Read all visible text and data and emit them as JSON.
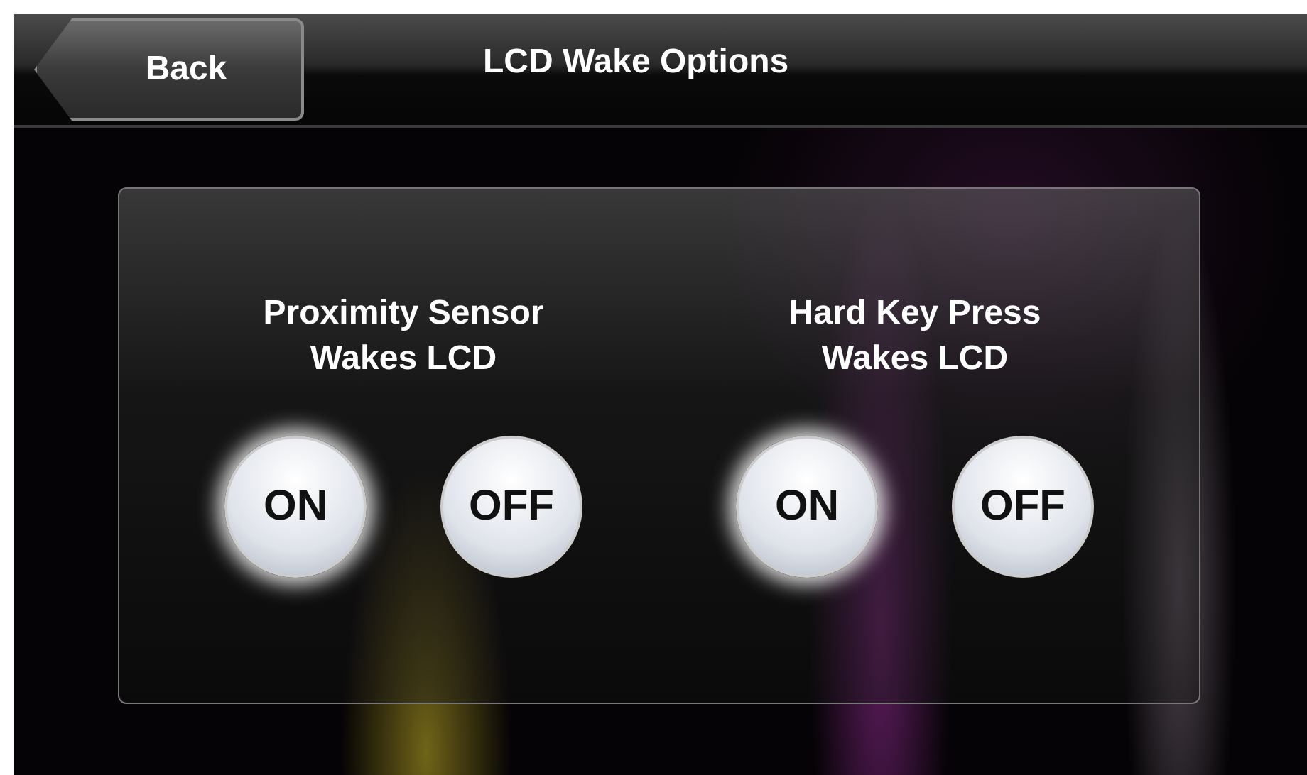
{
  "header": {
    "back_label": "Back",
    "title": "LCD Wake Options"
  },
  "groups": [
    {
      "label": "Proximity Sensor Wakes LCD",
      "options": [
        {
          "label": "ON",
          "selected": true
        },
        {
          "label": "OFF",
          "selected": false
        }
      ]
    },
    {
      "label": "Hard Key Press Wakes LCD",
      "options": [
        {
          "label": "ON",
          "selected": true
        },
        {
          "label": "OFF",
          "selected": false
        }
      ]
    }
  ]
}
